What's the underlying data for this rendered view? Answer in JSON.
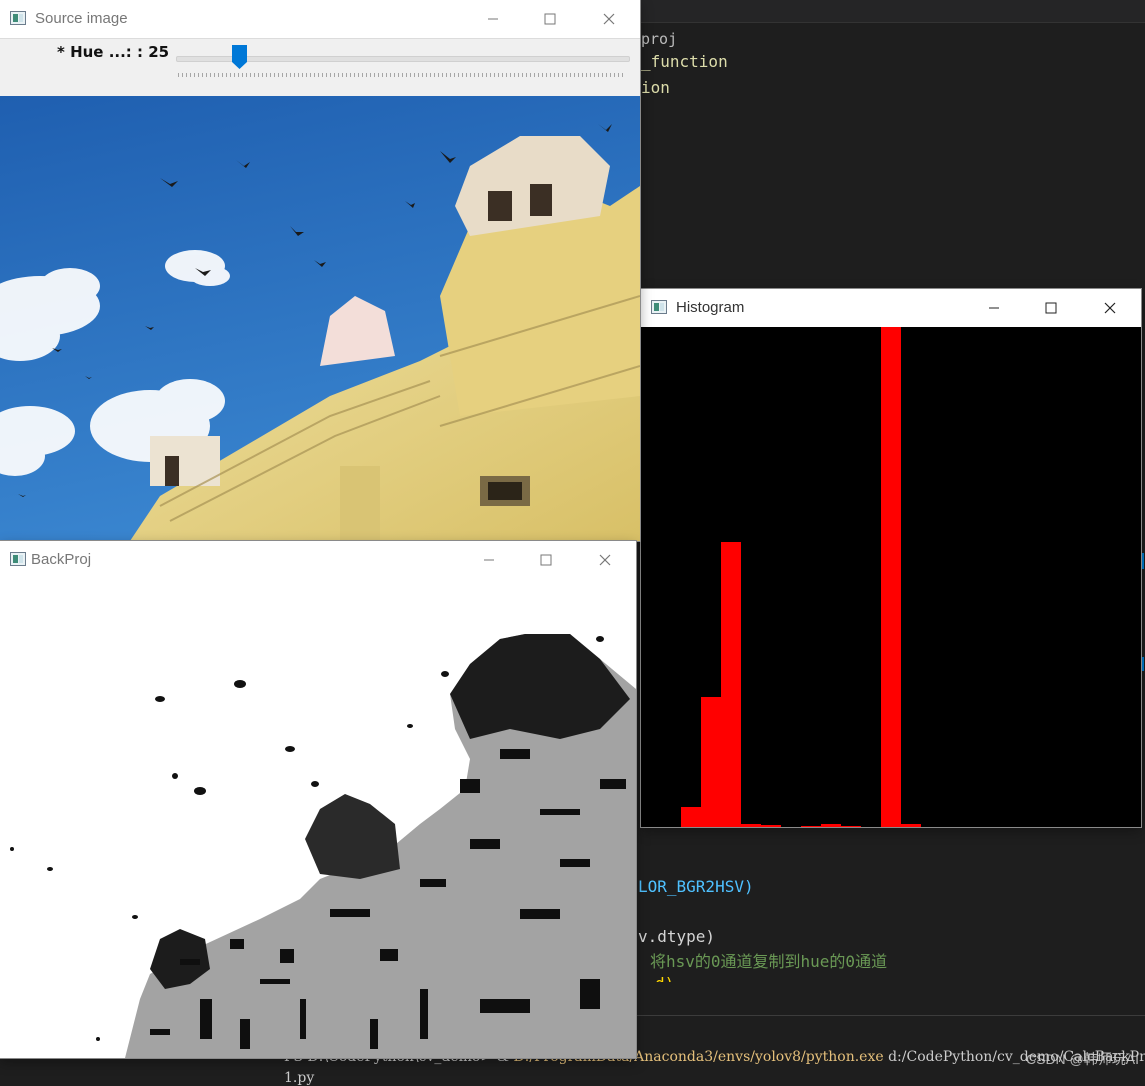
{
  "source_window": {
    "title": "Source image",
    "trackbar": {
      "label": "* Hue ...: : 25",
      "value": 25,
      "max": 180
    }
  },
  "histogram_window": {
    "title": "Histogram",
    "bins": [
      0,
      0,
      4,
      26,
      57,
      0.6,
      0.4,
      0,
      0.2,
      0.6,
      0.2,
      0,
      100,
      0.6,
      0,
      0,
      0
    ],
    "bar_color": "#ff0000"
  },
  "backproj_window": {
    "title": "BackProj"
  },
  "editor": {
    "line1": "proj",
    "line2": "_function",
    "line3": "ion",
    "line4": "LOR_BGR2HSV)",
    "line5": "v.dtype)",
    "line6": "将hsv的0通道复制到hue的0通道",
    "line7": "d)",
    "terminal_prefix": "PS D:\\CodePython\\cv_demo> & ",
    "terminal_python": "D:/ProgramData/Anaconda3/envs/yolov8/python.exe",
    "terminal_script": " d:/CodePython/cv_demo/CalcBackProj",
    "terminal_line2": "1.py",
    "watermark": "CSDN @韩师玩AI"
  },
  "colors": {
    "sky": "#2b6cb8",
    "building": "#e6d27a",
    "backproj_gray": "#a2a2a2",
    "accent": "#0078d7"
  }
}
